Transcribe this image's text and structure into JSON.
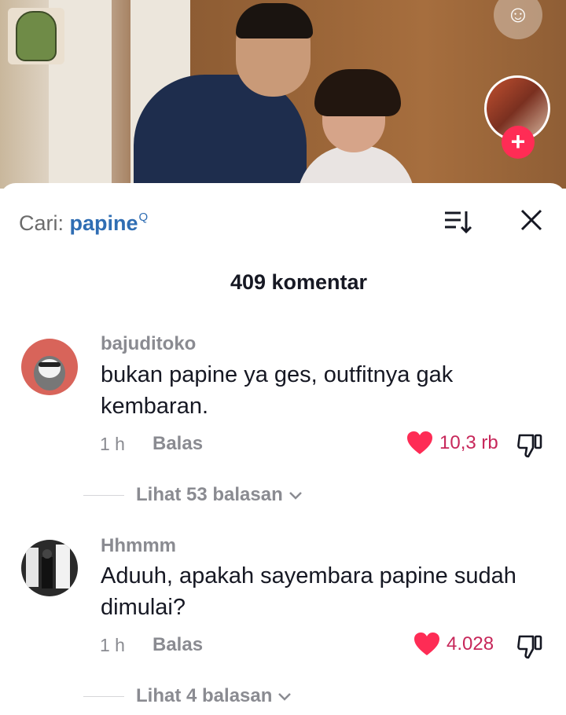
{
  "search": {
    "prefix": "Cari:",
    "term": "papine"
  },
  "comment_count_label": "409 komentar",
  "colors": {
    "like": "#fe2c55",
    "search_term": "#2f6db3",
    "follow": "#ff2c55"
  },
  "comments": [
    {
      "username": "bajuditoko",
      "text": "bukan papine ya ges, outfitnya gak kembaran.",
      "time": "1 h",
      "reply_label": "Balas",
      "likes": "10,3 rb",
      "view_replies": "Lihat 53 balasan"
    },
    {
      "username": "Hhmmm",
      "text": "Aduuh, apakah sayembara papine sudah dimulai?",
      "time": "1 h",
      "reply_label": "Balas",
      "likes": "4.028",
      "view_replies": "Lihat 4 balasan"
    }
  ],
  "icons": {
    "sort": "sort-icon",
    "close": "close-icon",
    "heart": "heart-icon",
    "dislike": "dislike-icon",
    "chevron": "chevron-down-icon",
    "follow": "plus-icon"
  }
}
